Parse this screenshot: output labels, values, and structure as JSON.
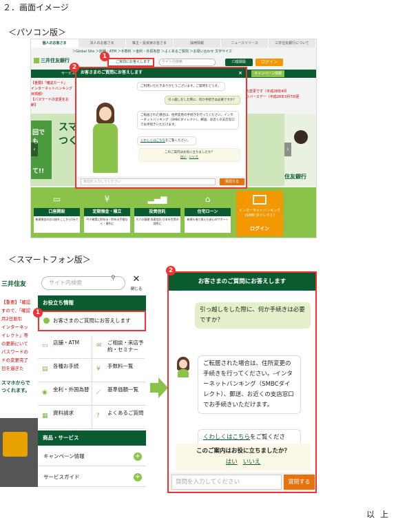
{
  "heading": "２．画面イメージ",
  "pc_label": "＜パソコン版＞",
  "sp_label": "＜スマートフォン版＞",
  "footer": "以上",
  "badges": [
    "1",
    "2"
  ],
  "pc": {
    "top_tabs": [
      "個人のお客さま",
      "法人のお客さま",
      "株主・投資家の皆さま",
      "採用情報",
      "ニュースリリース",
      "三井住友銀行について"
    ],
    "links": "＞Global Site  ＞店舗・ATM  ＞手数料  ＞金利・外貨為替  ＞よくあるご質問  ＞お問い合わせ  文字サイズ",
    "logo": "三井住友銀行",
    "question_button": "ご質問にお答えします",
    "search_placeholder": "サイト内検索",
    "pw_button": "口座開設",
    "login_button": "ログイン",
    "campaign": "キャンペーン情報",
    "service_menu": "サービス",
    "alerts": [
      "【重要】「確認カード」",
      "インターネットバンキング",
      "目標額）",
      "【パスワードの変更をお",
      "断】"
    ],
    "right_news": [
      "の変更です（平成28年4月",
      "りバースデー（平成28年3月7日更"
    ],
    "hero_text": [
      "スマホか",
      "つくれま"
    ],
    "hero_left": [
      "回でも",
      "て!!"
    ],
    "brand": "住友銀行",
    "tiles": [
      {
        "icon": "▭",
        "title": "口座開設",
        "desc": "普通預金のお口座をここから5分で"
      },
      {
        "icon": "¥",
        "title": "定期預金・積立",
        "desc": "円で確実に貯める・貯める手間なく・便利に"
      },
      {
        "icon": "▂▄▆",
        "title": "投資信託",
        "desc": "大人の基礎 投資信託 日本を世界の国際に"
      },
      {
        "icon": "⌂",
        "title": "住宅ローン",
        "desc": "新規も借り換えも安心のサポート"
      }
    ],
    "ib_tile": {
      "line1": "インターネットバンキング",
      "line2": "(SMBCダイレクト)",
      "login": "ログイン"
    },
    "dialog": {
      "title": "お客さまのご質問にお答えします",
      "close": "×",
      "greeting": "ご利用いただきありがとうございます。ご質問をどうぞ。",
      "user_msg": "引っ越しをした際に、何か手続きは必要ですか？",
      "bot_msg": "ご転居された場合は、住所変更の手続きを行ってください。インターネットバンキング（SMBCダイレクト）、郵送、お近くの支店窓口でお手続きいただけます。",
      "more_link": "くわしくはこちら",
      "more_suffix": "をご覧ください。",
      "help_q": "このご案内はお役に立ちましたか？",
      "yes": "はい",
      "no": "いいえ",
      "placeholder": "質問を入力してください",
      "send": "質問する"
    }
  },
  "sp": {
    "logo": "三井住友",
    "news": [
      "【重要】「確認",
      "すので、「確認",
      "月2日割引",
      "インターネッ",
      "イレクト」等",
      "の更新にいて",
      "パスワードの",
      "ドの変更完了",
      "日を過ぎた"
    ],
    "promo": [
      "スマホからで",
      "つくれます。"
    ],
    "search_placeholder": "サイト内検索",
    "close_label": "閉じる",
    "section1": "お役立ち情報",
    "question_item": "お客さまのご質問にお答えします",
    "grid": [
      {
        "icon": "▭",
        "label": "店舗・ATM"
      },
      {
        "icon": "✉",
        "label": "ご相談・来店予約・セミナー"
      },
      {
        "icon": "▤",
        "label": "各種お手続"
      },
      {
        "icon": "¥",
        "label": "手数料一覧"
      },
      {
        "icon": "◉",
        "label": "金利・外国為替"
      },
      {
        "icon": "⟋",
        "label": "基準価額一覧"
      },
      {
        "icon": "▦",
        "label": "資料請求"
      },
      {
        "icon": "?",
        "label": "よくあるご質問"
      }
    ],
    "section2": "商品・サービス",
    "list": [
      "キャンペーン情報",
      "サービスガイド"
    ],
    "plus": "+"
  },
  "sp_dialog": {
    "title": "お客さまのご質問にお答えします",
    "user_msg": "引っ越しをした際に、何か手続きは必要ですか？",
    "bot_msg": "ご転居された場合は、住所変更の手続きを行ってください。-インターネットバンキング（SMBCダイレクト）、郵送、お近くの支店窓口でお手続きいただけます。",
    "more_link": "くわしくはこちら",
    "more_suffix": "をご覧ください。",
    "help_q": "このご案内はお役に立ちましたか？",
    "yes": "はい",
    "no": "いいえ",
    "placeholder": "質問を入力してください",
    "send": "質問する"
  },
  "colors": {
    "green_dark": "#0a5b2f",
    "green_light": "#8bc34a",
    "orange": "#e8730d",
    "highlight_red": "#e33333"
  }
}
